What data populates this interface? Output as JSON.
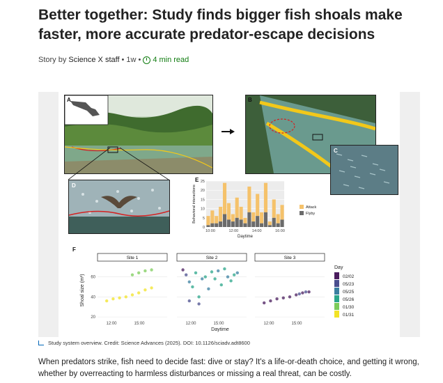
{
  "article": {
    "title": "Better together: Study finds bigger fish shoals make faster, more accurate predator-escape decisions",
    "byline_prefix": "Story by",
    "author": "Science X staff",
    "age": "1w",
    "separator": "•",
    "read_time": "4 min read",
    "caption": "Study system overview. Credit: Science Advances (2025). DOI: 10.1126/sciadv.adt8600",
    "body": "When predators strike, fish need to decide fast: dive or stay? It's a life-or-death choice, and getting it wrong, whether by overreacting to harmless disturbances or missing a real threat, can be costly."
  },
  "figure": {
    "panel_labels": [
      "A",
      "B",
      "C",
      "D",
      "E",
      "F"
    ],
    "colors": {
      "attack": "#f5c26b",
      "flyby": "#6b6b6b",
      "river": "#6a9a8e",
      "foliage": "#3f6b2e",
      "bird_line": "#d42020",
      "yellow_outline": "#f2c81a"
    },
    "chart_data": [
      {
        "type": "bar",
        "panel": "E",
        "stacked": true,
        "xlabel": "Daytime",
        "ylabel": "Behavioral interactions",
        "x_ticks": [
          "10:00",
          "12:00",
          "14:00",
          "16:00"
        ],
        "y_ticks": [
          0,
          5,
          10,
          15,
          20,
          25
        ],
        "ylim": [
          0,
          25
        ],
        "legend": "right",
        "series": [
          {
            "name": "Attack",
            "values": [
              5,
              7,
              4,
              8,
              17,
              9,
              4,
              11,
              7,
              3,
              14,
              5,
              12,
              6,
              16,
              2,
              10,
              5,
              8
            ]
          },
          {
            "name": "Flyby",
            "values": [
              1,
              2,
              2,
              3,
              7,
              4,
              3,
              5,
              4,
              2,
              8,
              3,
              6,
              2,
              8,
              1,
              5,
              2,
              4
            ]
          }
        ]
      },
      {
        "type": "scatter",
        "panel": "F",
        "xlabel": "Daytime",
        "ylabel": "Shoal size (m²)",
        "y_ticks": [
          20,
          40,
          60
        ],
        "ylim": [
          18,
          75
        ],
        "legend_title": "Day",
        "days": [
          "02/02",
          "05/23",
          "05/25",
          "05/26",
          "01/30",
          "01/31"
        ],
        "day_colors": [
          "#4a1c5e",
          "#4a4e8e",
          "#3a7fa0",
          "#2aa68a",
          "#7ccc5a",
          "#f2e326"
        ],
        "facets": [
          {
            "title": "Site 1",
            "x_ticks": [
              "12:00",
              "15:00"
            ],
            "points": [
              [
                0.1,
                36,
                5
              ],
              [
                0.2,
                38,
                5
              ],
              [
                0.3,
                39,
                5
              ],
              [
                0.4,
                40,
                5
              ],
              [
                0.5,
                42,
                5
              ],
              [
                0.6,
                44,
                5
              ],
              [
                0.7,
                47,
                5
              ],
              [
                0.8,
                49,
                5
              ],
              [
                0.5,
                62,
                4
              ],
              [
                0.6,
                64,
                4
              ],
              [
                0.7,
                66,
                4
              ],
              [
                0.8,
                67,
                4
              ]
            ]
          },
          {
            "title": "Site 2",
            "x_ticks": [
              "12:00",
              "15:00"
            ],
            "points": [
              [
                0.05,
                67,
                0
              ],
              [
                0.1,
                62,
                1
              ],
              [
                0.15,
                55,
                2
              ],
              [
                0.2,
                50,
                3
              ],
              [
                0.25,
                64,
                3
              ],
              [
                0.3,
                40,
                3
              ],
              [
                0.35,
                58,
                2
              ],
              [
                0.4,
                60,
                3
              ],
              [
                0.45,
                48,
                2
              ],
              [
                0.5,
                65,
                3
              ],
              [
                0.55,
                58,
                3
              ],
              [
                0.6,
                66,
                2
              ],
              [
                0.65,
                52,
                3
              ],
              [
                0.7,
                68,
                3
              ],
              [
                0.75,
                60,
                2
              ],
              [
                0.8,
                56,
                3
              ],
              [
                0.85,
                62,
                3
              ],
              [
                0.9,
                64,
                2
              ],
              [
                0.15,
                36,
                1
              ],
              [
                0.3,
                33,
                1
              ]
            ]
          },
          {
            "title": "Site 3",
            "x_ticks": [
              "12:00",
              "15:00"
            ],
            "points": [
              [
                0.1,
                34,
                0
              ],
              [
                0.2,
                36,
                0
              ],
              [
                0.3,
                38,
                0
              ],
              [
                0.4,
                39,
                0
              ],
              [
                0.5,
                40,
                0
              ],
              [
                0.6,
                42,
                0
              ],
              [
                0.7,
                44,
                0
              ],
              [
                0.8,
                45,
                0
              ],
              [
                0.65,
                43,
                1
              ],
              [
                0.75,
                45,
                1
              ]
            ]
          }
        ]
      }
    ]
  }
}
